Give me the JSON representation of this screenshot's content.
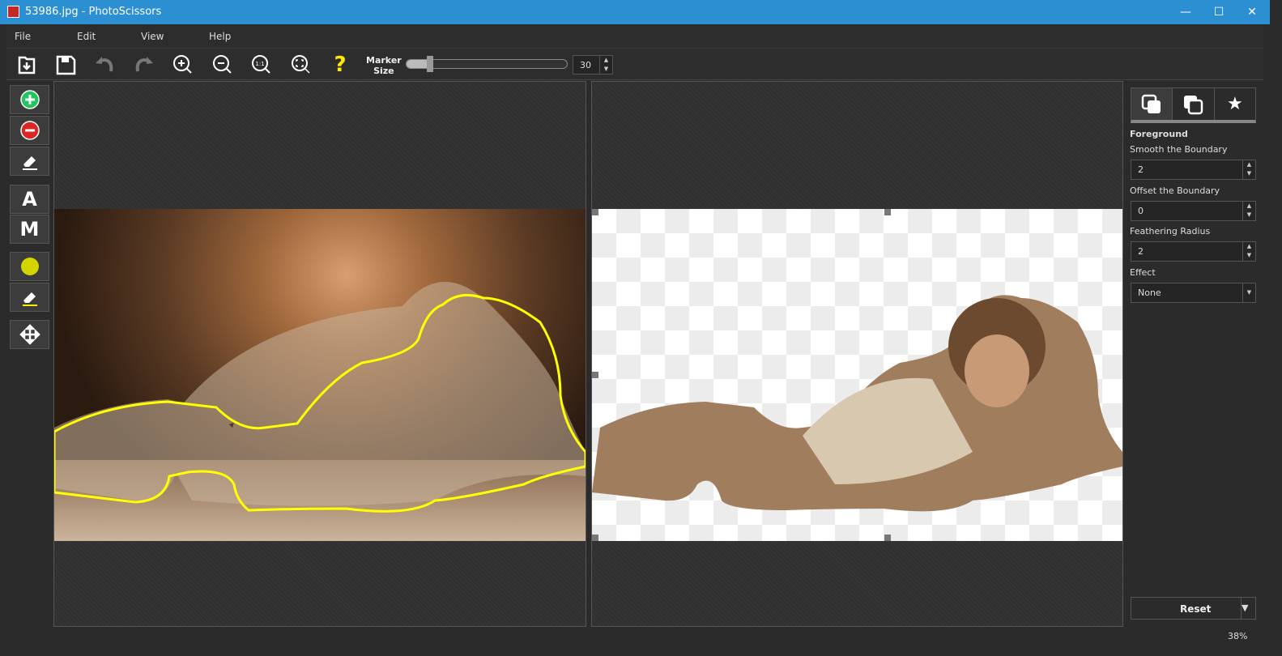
{
  "window": {
    "title": "53986.jpg - PhotoScissors",
    "minimize": "—",
    "maximize": "☐",
    "close": "✕"
  },
  "menu": [
    "File",
    "Edit",
    "View",
    "Help"
  ],
  "toolbar": {
    "marker_label_1": "Marker",
    "marker_label_2": "Size",
    "marker_size": "30",
    "marker_fraction": 0.1,
    "help": "?",
    "zoom_1to1": "1:1"
  },
  "tools": {
    "text_tool": "A",
    "manual_tool": "M"
  },
  "panel": {
    "section": "Foreground",
    "smooth_label": "Smooth the Boundary",
    "smooth_value": "2",
    "offset_label": "Offset the Boundary",
    "offset_value": "0",
    "feather_label": "Feathering Radius",
    "feather_value": "2",
    "effect_label": "Effect",
    "effect_value": "None",
    "reset": "Reset"
  },
  "status": {
    "zoom": "38%"
  },
  "colors": {
    "titlebar": "#2b8fd1",
    "outline": "#ffff00",
    "add": "#22c55e",
    "remove": "#dc2626"
  }
}
